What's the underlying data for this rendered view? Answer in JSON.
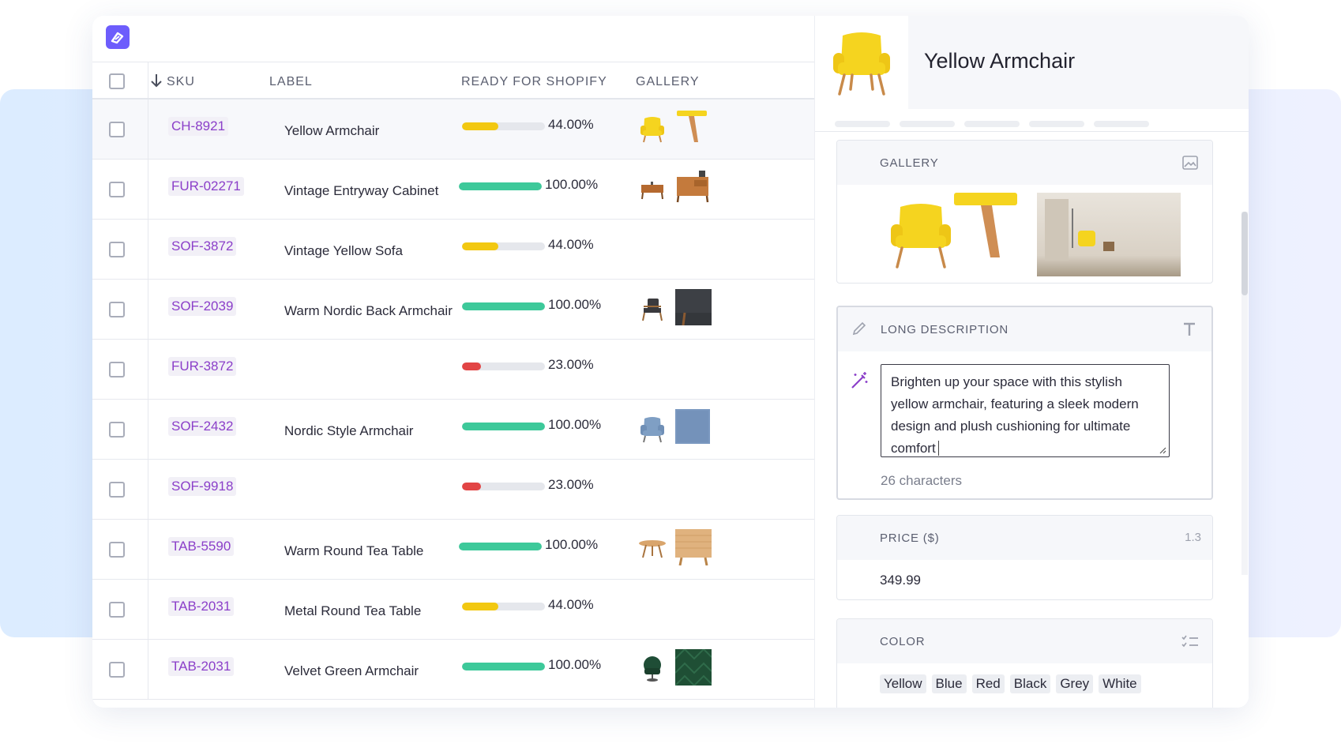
{
  "columns": {
    "sku": "SKU",
    "label": "LABEL",
    "ready": "READY FOR SHOPIFY",
    "gallery": "GALLERY"
  },
  "rows": [
    {
      "sku": "CH-8921",
      "label": "Yellow Armchair",
      "progress": 44,
      "pct": "44.00%",
      "color": "#f2c811"
    },
    {
      "sku": "FUR-02271",
      "label": "Vintage Entryway Cabinet",
      "progress": 100,
      "pct": "100.00%",
      "color": "#3dc99a"
    },
    {
      "sku": "SOF-3872",
      "label": "Vintage Yellow Sofa",
      "progress": 44,
      "pct": "44.00%",
      "color": "#f2c811"
    },
    {
      "sku": "SOF-2039",
      "label": "Warm Nordic Back Armchair",
      "progress": 100,
      "pct": "100.00%",
      "color": "#3dc99a"
    },
    {
      "sku": "FUR-3872",
      "label": "",
      "progress": 23,
      "pct": "23.00%",
      "color": "#e24545"
    },
    {
      "sku": "SOF-2432",
      "label": "Nordic Style Armchair",
      "progress": 100,
      "pct": "100.00%",
      "color": "#3dc99a"
    },
    {
      "sku": "SOF-9918",
      "label": "",
      "progress": 23,
      "pct": "23.00%",
      "color": "#e24545"
    },
    {
      "sku": "TAB-5590",
      "label": "Warm Round Tea Table",
      "progress": 100,
      "pct": "100.00%",
      "color": "#3dc99a"
    },
    {
      "sku": "TAB-2031",
      "label": "Metal Round Tea Table",
      "progress": 44,
      "pct": "44.00%",
      "color": "#f2c811"
    },
    {
      "sku": "TAB-2031",
      "label": "Velvet Green Armchair",
      "progress": 100,
      "pct": "100.00%",
      "color": "#3dc99a"
    }
  ],
  "panel": {
    "title": "Yellow Armchair",
    "gallery_title": "GALLERY",
    "description_title": "LONG DESCRIPTION",
    "description": "Brighten up your space with this stylish yellow armchair, featuring a sleek modern design and plush cushioning for ultimate comfort",
    "char_count": "26 characters",
    "price_title": "PRICE ($)",
    "price_icon_text": "1.3",
    "price": "349.99",
    "color_title": "COLOR",
    "colors": [
      "Yellow",
      "Blue",
      "Red",
      "Black",
      "Grey",
      "White"
    ]
  }
}
